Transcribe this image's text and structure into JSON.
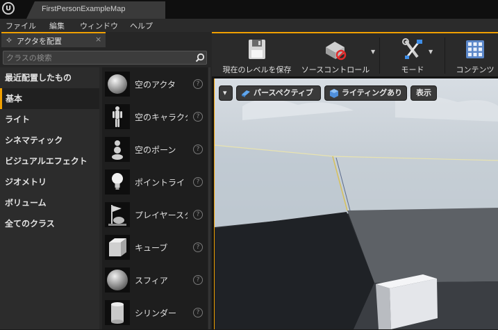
{
  "window": {
    "logo": "U",
    "doc_tab": "FirstPersonExampleMap"
  },
  "menu": [
    "ファイル",
    "編集",
    "ウィンドウ",
    "ヘルプ"
  ],
  "place_panel": {
    "tab_label": "アクタを配置",
    "close": "×",
    "search_placeholder": "クラスの検索",
    "categories": [
      "最近配置したもの",
      "基本",
      "ライト",
      "シネマティック",
      "ビジュアルエフェクト",
      "ジオメトリ",
      "ボリューム",
      "全てのクラス"
    ],
    "selected_category": "基本",
    "items": [
      {
        "label": "空のアクタ",
        "icon": "sphere-icon"
      },
      {
        "label": "空のキャラクター",
        "icon": "character-icon"
      },
      {
        "label": "空のポーン",
        "icon": "pawn-icon"
      },
      {
        "label": "ポイントライト",
        "icon": "lightbulb-icon"
      },
      {
        "label": "プレイヤースタート",
        "icon": "player-start-icon"
      },
      {
        "label": "キューブ",
        "icon": "cube-icon"
      },
      {
        "label": "スフィア",
        "icon": "sphere-icon"
      },
      {
        "label": "シリンダー",
        "icon": "cylinder-icon"
      }
    ],
    "help_glyph": "?"
  },
  "toolbar": {
    "save": "現在のレベルを保存",
    "source_control": "ソースコントロール",
    "modes": "モード",
    "content": "コンテンツ",
    "arrow": "▼"
  },
  "viewport": {
    "dropdown": "▾",
    "perspective": "パースペクティブ",
    "lighting": "ライティングあり",
    "show": "表示"
  },
  "colors": {
    "accent": "#f0a000",
    "panel": "#262626",
    "toolbar": "#2a2a2a"
  }
}
